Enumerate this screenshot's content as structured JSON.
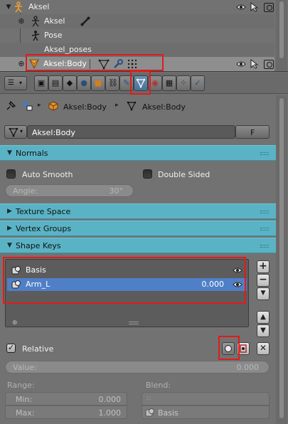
{
  "outliner": {
    "rows": [
      {
        "label": "Aksel"
      },
      {
        "label": "Aksel"
      },
      {
        "label": "Pose"
      },
      {
        "label": "Aksel_poses"
      },
      {
        "label": "Aksel:Body"
      }
    ]
  },
  "breadcrumb": {
    "object": "Aksel:Body",
    "data": "Aksel:Body"
  },
  "datablock": {
    "name": "Aksel:Body",
    "fake_user": "F"
  },
  "panels": {
    "normals": {
      "title": "Normals",
      "auto_smooth": "Auto Smooth",
      "double_sided": "Double Sided",
      "angle_label": "Angle:",
      "angle_value": "30°"
    },
    "texture_space": {
      "title": "Texture Space"
    },
    "vertex_groups": {
      "title": "Vertex Groups"
    },
    "shape_keys": {
      "title": "Shape Keys",
      "items": [
        {
          "name": "Basis",
          "value": ""
        },
        {
          "name": "Arm_L",
          "value": "0.000"
        }
      ],
      "relative": "Relative",
      "value_label": "Value:",
      "value": "0.000",
      "range_label": "Range:",
      "min_label": "Min:",
      "min_value": "0.000",
      "max_label": "Max:",
      "max_value": "1.000",
      "blend_label": "Blend:",
      "blend_value": "Basis"
    }
  },
  "colors": {
    "panel_header": "#5ab3c5",
    "selection": "#4f7fc7",
    "highlight_box": "#e01b1b"
  }
}
